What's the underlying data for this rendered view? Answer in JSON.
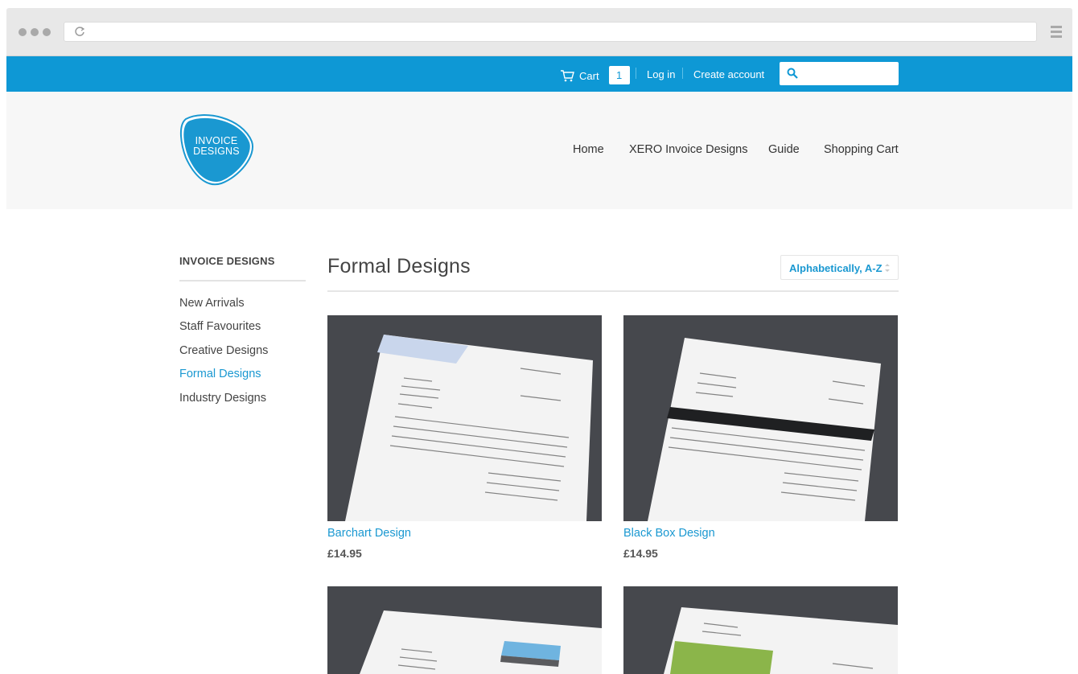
{
  "topbar": {
    "cart_label": "Cart",
    "cart_count": "1",
    "login_label": "Log in",
    "create_account_label": "Create account",
    "search_placeholder": ""
  },
  "logo": {
    "line1": "INVOICE",
    "line2": "DESIGNS"
  },
  "nav": [
    "Home",
    "XERO Invoice Designs",
    "Guide",
    "Shopping Cart"
  ],
  "sidebar": {
    "title": "INVOICE DESIGNS",
    "items": [
      {
        "label": "New Arrivals",
        "active": false
      },
      {
        "label": "Staff Favourites",
        "active": false
      },
      {
        "label": "Creative Designs",
        "active": false
      },
      {
        "label": "Formal Designs",
        "active": true
      },
      {
        "label": "Industry Designs",
        "active": false
      }
    ]
  },
  "main": {
    "title": "Formal Designs",
    "sort_label": "Alphabetically, A-Z"
  },
  "products": [
    {
      "name": "Barchart Design",
      "price": "£14.95"
    },
    {
      "name": "Black Box Design",
      "price": "£14.95"
    },
    {
      "name": "",
      "price": ""
    },
    {
      "name": "",
      "price": ""
    }
  ],
  "colors": {
    "accent": "#0e98d5",
    "link": "#1a98d1"
  }
}
